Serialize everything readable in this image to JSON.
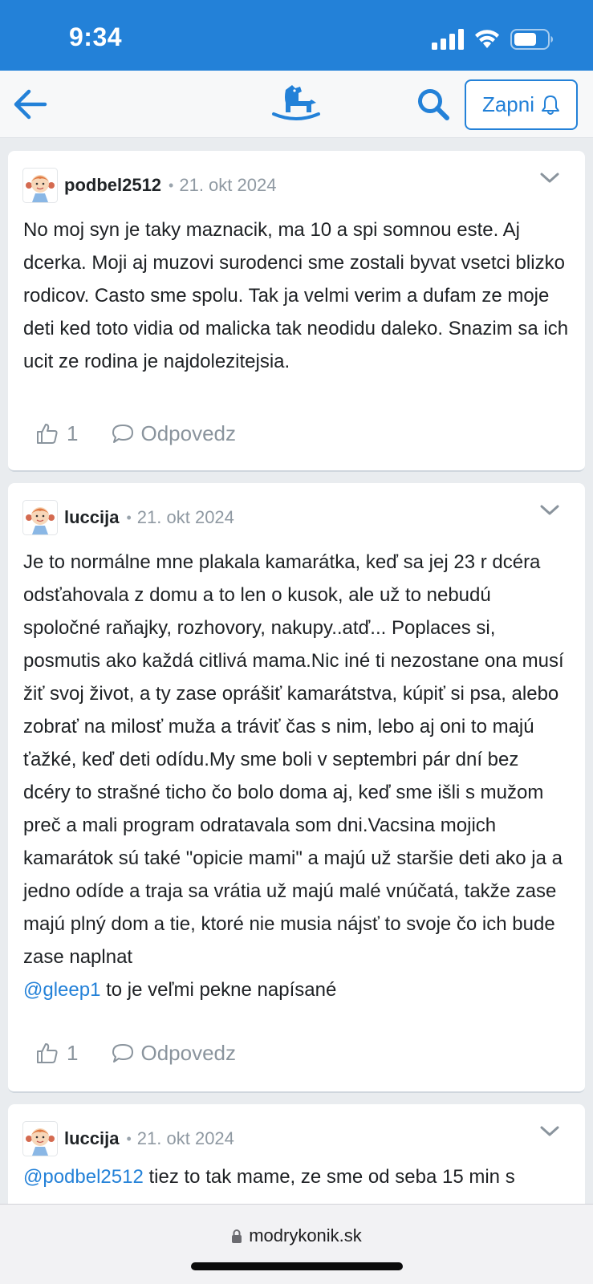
{
  "status_bar": {
    "time": "9:34"
  },
  "nav": {
    "subscribe_label": "Zapni",
    "logo_icon": "rocking-horse-icon"
  },
  "colors": {
    "brand": "#2381d8",
    "link": "#2381d8",
    "muted": "#8f99a2"
  },
  "posts": [
    {
      "author": "podbel2512",
      "separator": "•",
      "date": "21. okt 2024",
      "text": "No moj syn je taky maznacik, ma 10 a spi somnou este. Aj dcerka. Moji aj muzovi surodenci sme zostali byvat vsetci blizko rodicov. Casto sme spolu. Tak ja velmi verim a dufam ze moje deti ked toto vidia od malicka tak neodidu daleko. Snazim sa ich ucit ze rodina je najdolezitejsia.",
      "likes": "1",
      "reply_label": "Odpovedz"
    },
    {
      "author": "luccija",
      "separator": "•",
      "date": "21. okt 2024",
      "text": "Je to normálne mne plakala kamarátka, keď sa jej 23 r dcéra odsťahovala z domu a to len o kusok, ale už to nebudú spoločné raňajky, rozhovory, nakupy..atď... Poplaces si, posmutis ako každá citlivá mama.Nic iné ti nezostane ona musí žiť svoj život, a ty zase oprášiť kamarátstva, kúpiť si psa, alebo zobrať na milosť muža a tráviť čas s nim, lebo aj oni to majú ťažké, keď deti odídu.My sme boli v septembri pár dní bez dcéry to strašné ticho čo bolo doma aj, keď sme išli s mužom preč a mali program odratavala som dni.Vacsina mojich kamarátok sú také \"opicie mami\" a majú už staršie deti ako ja a jedno odíde a traja sa vrátia už majú malé vnúčatá, takže zase majú plný dom a tie, ktoré nie musia nájsť to svoje čo ich bude zase naplnat",
      "mention": "@gleep1",
      "mention_text": " to je veľmi pekne napísané",
      "likes": "1",
      "reply_label": "Odpovedz"
    },
    {
      "author": "luccija",
      "separator": "•",
      "date": "21. okt 2024",
      "mention": "@podbel2512",
      "mention_text": " tiez to tak mame, ze sme od seba 15 min s"
    }
  ],
  "browser": {
    "url": "modrykonik.sk"
  }
}
